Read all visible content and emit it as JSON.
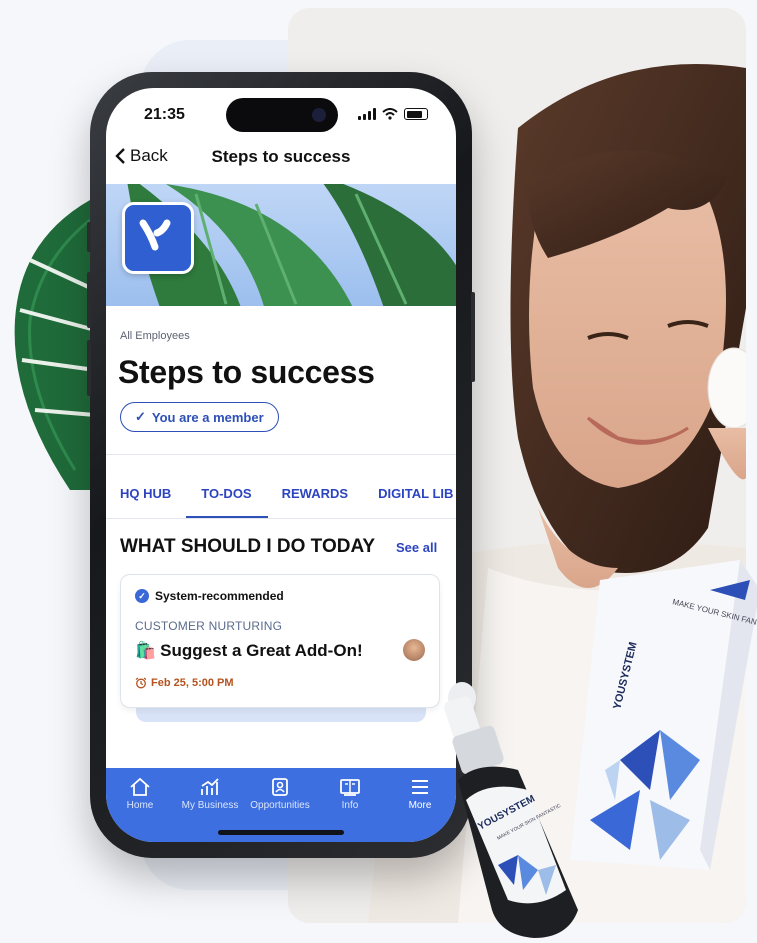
{
  "phone": {
    "status_time": "21:35",
    "nav": {
      "back_label": "Back",
      "title": "Steps to success"
    },
    "group": {
      "audience": "All Employees",
      "title": "Steps to success",
      "member_badge": "You are a member"
    },
    "tabs": [
      {
        "label": "HQ HUB",
        "active": false
      },
      {
        "label": "TO-DOS",
        "active": true
      },
      {
        "label": "REWARDS",
        "active": false
      },
      {
        "label": "DIGITAL LIB",
        "active": false
      }
    ],
    "section": {
      "heading": "WHAT SHOULD I DO TODAY",
      "see_all": "See all"
    },
    "card": {
      "badge": "System-recommended",
      "category": "CUSTOMER NURTURING",
      "emoji": "🛍️",
      "title": "Suggest a Great Add-On!",
      "due": "Feb 25, 5:00 PM"
    },
    "tabbar": [
      {
        "label": "Home",
        "icon": "home-icon"
      },
      {
        "label": "My Business",
        "icon": "chart-icon"
      },
      {
        "label": "Opportunities",
        "icon": "id-card-icon"
      },
      {
        "label": "Info",
        "icon": "book-icon"
      },
      {
        "label": "More",
        "icon": "menu-icon"
      }
    ]
  },
  "product": {
    "brand": "YOUSYSTEM",
    "box_tagline": "MAKE YOUR SKIN FANTASTIC",
    "bottle_tagline": "MAKE YOUR SKIN FANTASTIC"
  },
  "colors": {
    "accent": "#2c44c0",
    "tabbar": "#3d6fe0",
    "due": "#b4531f"
  }
}
